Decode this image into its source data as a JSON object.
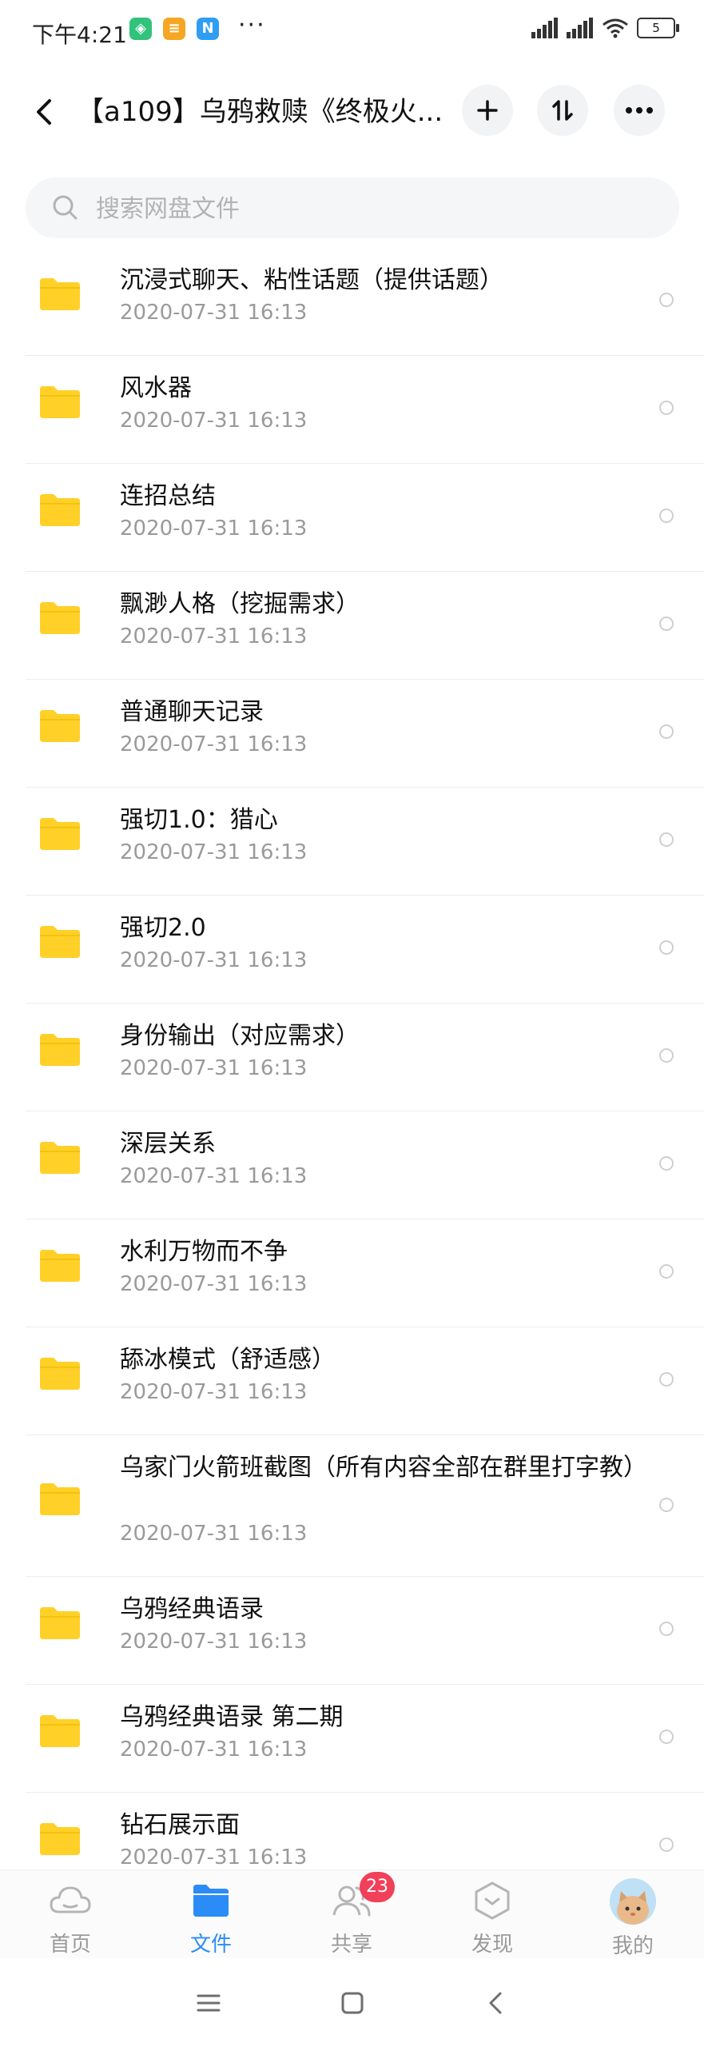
{
  "status_bar": {
    "time": "下午4:21",
    "apps": [
      {
        "name": "shield-app-icon",
        "glyph": "◈",
        "color": "#31c27c"
      },
      {
        "name": "notes-app-icon",
        "glyph": "≡",
        "color": "#f5a623"
      },
      {
        "name": "n-app-icon",
        "glyph": "N",
        "color": "#2f9df4"
      }
    ],
    "more_dots": "···",
    "battery": "5"
  },
  "header": {
    "title": "【a109】乌鸦救赎《终极火..."
  },
  "search": {
    "placeholder": "搜索网盘文件"
  },
  "files": [
    {
      "name": "沉浸式聊天、粘性话题（提供话题）",
      "date": "2020-07-31  16:13"
    },
    {
      "name": "风水器",
      "date": "2020-07-31  16:13"
    },
    {
      "name": "连招总结",
      "date": "2020-07-31  16:13"
    },
    {
      "name": "飘渺人格（挖掘需求）",
      "date": "2020-07-31  16:13"
    },
    {
      "name": "普通聊天记录",
      "date": "2020-07-31  16:13"
    },
    {
      "name": "强切1.0：猎心",
      "date": "2020-07-31  16:13"
    },
    {
      "name": "强切2.0",
      "date": "2020-07-31  16:13"
    },
    {
      "name": "身份输出（对应需求）",
      "date": "2020-07-31  16:13"
    },
    {
      "name": "深层关系",
      "date": "2020-07-31  16:13"
    },
    {
      "name": "水利万物而不争",
      "date": "2020-07-31  16:13"
    },
    {
      "name": "舔冰模式（舒适感）",
      "date": "2020-07-31  16:13"
    },
    {
      "name": "乌家门火箭班截图（所有内容全部在群里打字教）",
      "date": "2020-07-31  16:13"
    },
    {
      "name": "乌鸦经典语录",
      "date": "2020-07-31  16:13"
    },
    {
      "name": "乌鸦经典语录 第二期",
      "date": "2020-07-31  16:13"
    },
    {
      "name": "钻石展示面",
      "date": "2020-07-31  16:13"
    }
  ],
  "bottom_nav": {
    "home": "首页",
    "files": "文件",
    "share": "共享",
    "share_badge": "23",
    "discover": "发现",
    "me": "我的"
  },
  "colors": {
    "accent": "#2b8cf7",
    "folder": "#ffd027",
    "badge": "#f2405a"
  }
}
